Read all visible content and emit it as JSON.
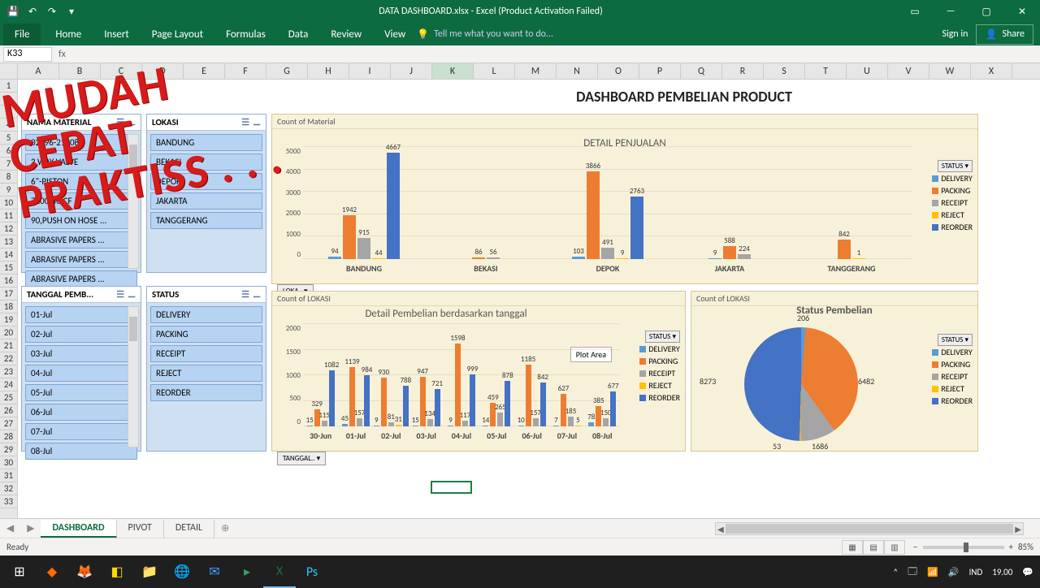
{
  "window": {
    "title": "DATA DASHBOARD.xlsx - Excel (Product Activation Failed)",
    "signin": "Sign in",
    "share": "Share",
    "tell": "Tell me what you want to do..."
  },
  "ribbonTabs": [
    "File",
    "Home",
    "Insert",
    "Page Layout",
    "Formulas",
    "Data",
    "Review",
    "View"
  ],
  "namebox": "K33",
  "columns": [
    "A",
    "B",
    "C",
    "D",
    "E",
    "F",
    "G",
    "H",
    "I",
    "J",
    "K",
    "L",
    "M",
    "N",
    "O",
    "P",
    "Q",
    "R",
    "S",
    "T",
    "U",
    "V",
    "W",
    "X"
  ],
  "activeCol": "K",
  "rows_start": 1,
  "rows_end": 33,
  "dashTitle": "DASHBOARD PEMBELIAN PRODUCT",
  "slicers": {
    "material": {
      "title": "NAMA MATERIAL",
      "items": [
        "02896-21008",
        "3 WAY VALVE",
        "6\"-PISTON",
        "7100-40ICF",
        "90,PUSH ON HOSE ...",
        "ABRASIVE PAPERS ...",
        "ABRASIVE PAPERS ...",
        "ABRASIVE PAPERS ..."
      ]
    },
    "lokasi": {
      "title": "LOKASI",
      "items": [
        "BANDUNG",
        "BEKASI",
        "DEPOK",
        "JAKARTA",
        "TANGGERANG"
      ]
    },
    "tanggal": {
      "title": "TANGGAL PEMB...",
      "items": [
        "01-Jul",
        "02-Jul",
        "03-Jul",
        "04-Jul",
        "05-Jul",
        "06-Jul",
        "07-Jul",
        "08-Jul"
      ]
    },
    "status": {
      "title": "STATUS",
      "items": [
        "DELIVERY",
        "PACKING",
        "RECEIPT",
        "REJECT",
        "REORDER"
      ]
    }
  },
  "legendStatus": [
    "DELIVERY",
    "PACKING",
    "RECEIPT",
    "REJECT",
    "REORDER"
  ],
  "legendColors": [
    "#5b9bd5",
    "#ed7d31",
    "#a5a5a5",
    "#ffc000",
    "#4472c4"
  ],
  "chart_data": [
    {
      "type": "bar",
      "title": "DETAIL PENJUALAN",
      "count_label": "Count of Material",
      "ylim": [
        0,
        5000
      ],
      "yticks": [
        0,
        1000,
        2000,
        3000,
        4000,
        5000
      ],
      "xlabel_btn": "LOKA.. ▾",
      "status_btn": "STATUS ▾",
      "categories": [
        "BANDUNG",
        "BEKASI",
        "DEPOK",
        "JAKARTA",
        "TANGGERANG"
      ],
      "series": [
        {
          "name": "DELIVERY",
          "values": [
            94,
            null,
            103,
            9,
            null
          ]
        },
        {
          "name": "PACKING",
          "values": [
            1942,
            86,
            3866,
            588,
            842
          ]
        },
        {
          "name": "RECEIPT",
          "values": [
            915,
            56,
            491,
            224,
            null
          ]
        },
        {
          "name": "REJECT",
          "values": [
            44,
            null,
            9,
            null,
            1
          ]
        },
        {
          "name": "REORDER",
          "values": [
            4667,
            null,
            2763,
            null,
            null
          ]
        }
      ]
    },
    {
      "type": "bar",
      "title": "Detail Pembelian berdasarkan tanggal",
      "count_label": "Count of LOKASI",
      "ylim": [
        0,
        2000
      ],
      "yticks": [
        0,
        500,
        1000,
        1500,
        2000
      ],
      "xlabel_btn": "TANGGAL.. ▾",
      "status_btn": "STATUS ▾",
      "plot_area_label": "Plot Area",
      "categories": [
        "30-Jun",
        "01-Jul",
        "02-Jul",
        "03-Jul",
        "04-Jul",
        "05-Jul",
        "06-Jul",
        "07-Jul",
        "08-Jul"
      ],
      "series": [
        {
          "name": "DELIVERY",
          "values": [
            15,
            45,
            9,
            15,
            9,
            14,
            10,
            7,
            78
          ]
        },
        {
          "name": "PACKING",
          "values": [
            329,
            1139,
            930,
            947,
            1598,
            459,
            1185,
            627,
            385
          ]
        },
        {
          "name": "RECEIPT",
          "values": [
            115,
            157,
            81,
            134,
            117,
            265,
            157,
            185,
            150
          ]
        },
        {
          "name": "REJECT",
          "values": [
            null,
            null,
            31,
            null,
            null,
            null,
            null,
            5,
            null
          ]
        },
        {
          "name": "REORDER",
          "values": [
            1082,
            984,
            788,
            721,
            999,
            878,
            842,
            null,
            677
          ]
        }
      ]
    },
    {
      "type": "pie",
      "title": "Status Pembelian",
      "count_label": "Count of LOKASI",
      "status_btn": "STATUS ▾",
      "labels": [
        "DELIVERY",
        "PACKING",
        "RECEIPT",
        "REJECT",
        "REORDER"
      ],
      "values": [
        206,
        6482,
        1686,
        53,
        8273
      ]
    }
  ],
  "sheetTabs": [
    "DASHBOARD",
    "PIVOT",
    "DETAIL"
  ],
  "activeTab": "DASHBOARD",
  "status": {
    "ready": "Ready",
    "zoom": "85%"
  },
  "tray": {
    "lang": "IND",
    "time": "19.00"
  },
  "overlay": [
    "MUDAH",
    "CEPAT",
    "PRAKTISS . . ."
  ]
}
